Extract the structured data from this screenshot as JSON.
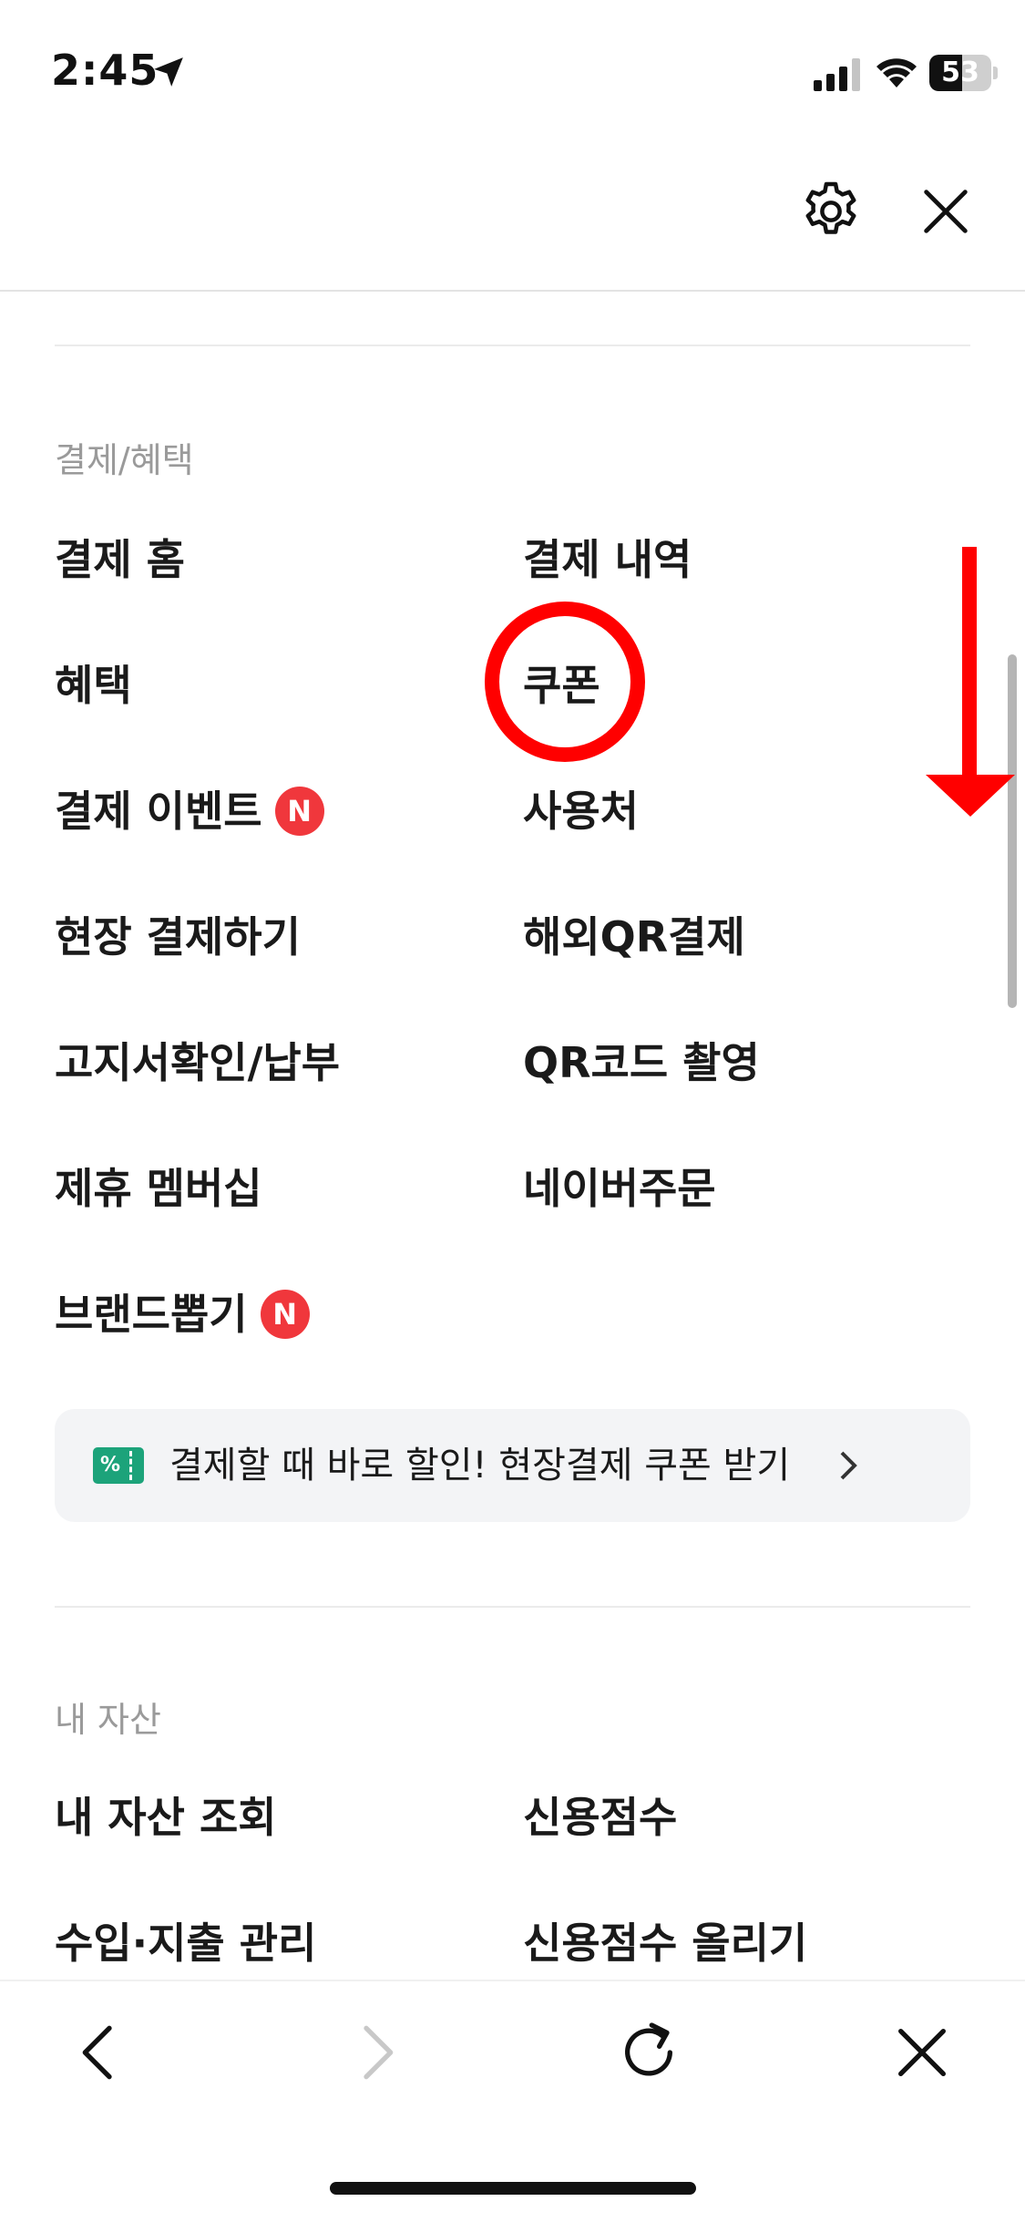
{
  "status_bar": {
    "time": "2:45",
    "battery": "53",
    "battery_level": 0.53
  },
  "sections": [
    {
      "title": "결제/혜택",
      "items": [
        {
          "label": "결제 홈"
        },
        {
          "label": "결제 내역"
        },
        {
          "label": "혜택"
        },
        {
          "label": "쿠폰"
        },
        {
          "label": "결제 이벤트",
          "badge": "N"
        },
        {
          "label": "사용처"
        },
        {
          "label": "현장 결제하기"
        },
        {
          "label": "해외QR결제"
        },
        {
          "label": "고지서확인/납부"
        },
        {
          "label": "QR코드 촬영"
        },
        {
          "label": "제휴 멤버십"
        },
        {
          "label": "네이버주문"
        },
        {
          "label": "브랜드뽑기",
          "badge": "N"
        }
      ],
      "promo": {
        "icon_text": "%",
        "text": "결제할 때 바로 할인! 현장결제 쿠폰 받기"
      }
    },
    {
      "title": "내 자산",
      "items": [
        {
          "label": "내 자산 조회"
        },
        {
          "label": "신용점수"
        },
        {
          "label": "수입·지출 관리"
        },
        {
          "label": "신용점수 올리기"
        }
      ]
    }
  ],
  "icons": {
    "header": [
      "gear-icon",
      "close-icon"
    ],
    "bottom_nav": [
      "back-icon",
      "forward-icon",
      "refresh-icon",
      "close-icon"
    ]
  },
  "colors": {
    "badge": "#f0373c",
    "promo_icon": "#1ca37a",
    "annotation": "#ff0000",
    "section_title": "#9a9a9a"
  }
}
